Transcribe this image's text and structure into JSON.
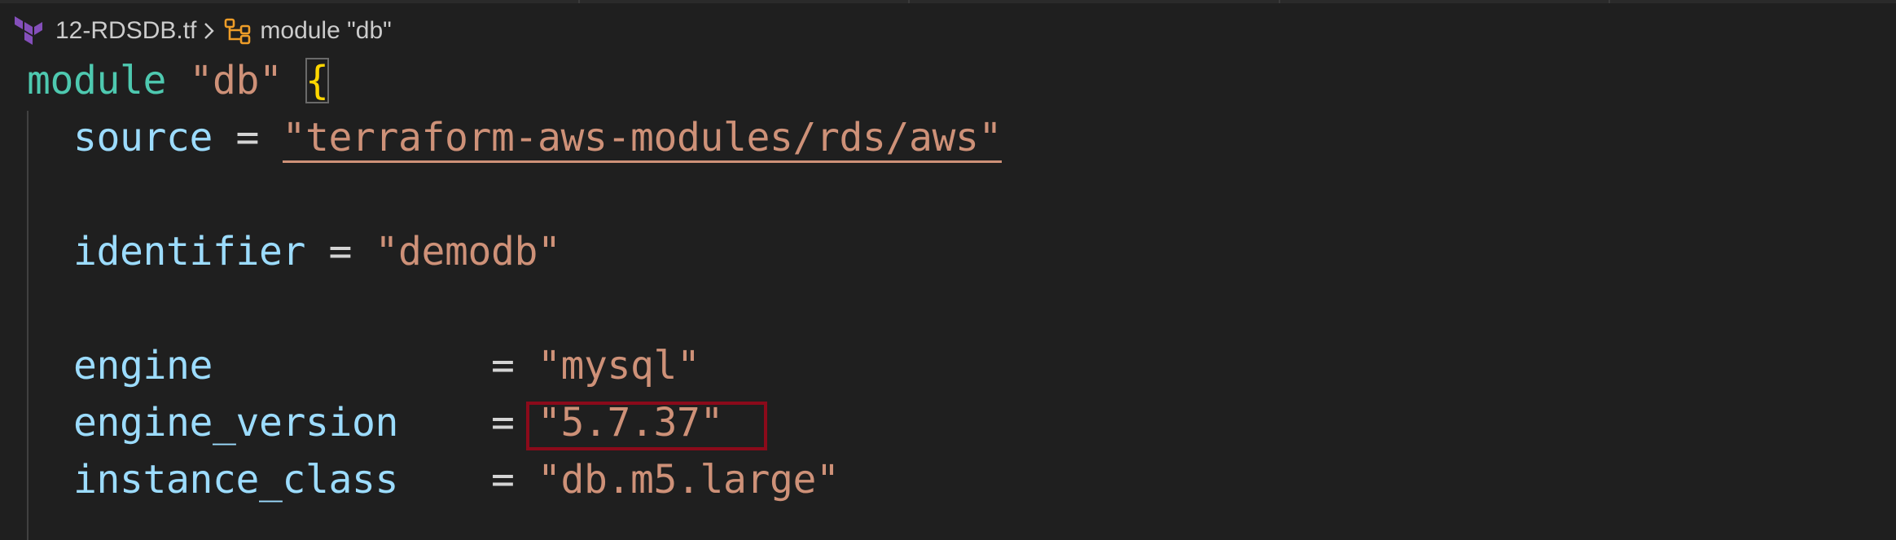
{
  "breadcrumb": {
    "file_name": "12-RDSDB.tf",
    "symbol_label": "module \"db\""
  },
  "code": {
    "line1": {
      "keyword": "module",
      "name": "\"db\"",
      "brace": "{"
    },
    "line2": {
      "key": "source",
      "op": "=",
      "value": "\"terraform-aws-modules/rds/aws\""
    },
    "line4": {
      "key": "identifier",
      "op": "=",
      "value": "\"demodb\""
    },
    "line6": {
      "key": "engine",
      "op": "=",
      "value": "\"mysql\""
    },
    "line7": {
      "key": "engine_version",
      "op": "=",
      "value": "\"5.7.37\""
    },
    "line8": {
      "key": "instance_class",
      "op": "=",
      "value": "\"db.m5.large\""
    }
  },
  "colors": {
    "background": "#1f1f1f",
    "keyword": "#4ec9b0",
    "string": "#ce9178",
    "attribute": "#9cdcfe",
    "brace": "#ffd700",
    "highlight_box": "#8b0a1a",
    "terraform_icon": "#844fba",
    "symbol_icon": "#ee9d28"
  },
  "icons": {
    "file_icon": "terraform-icon",
    "separator_icon": "chevron-right-icon",
    "symbol_icon": "symbol-module-icon"
  }
}
